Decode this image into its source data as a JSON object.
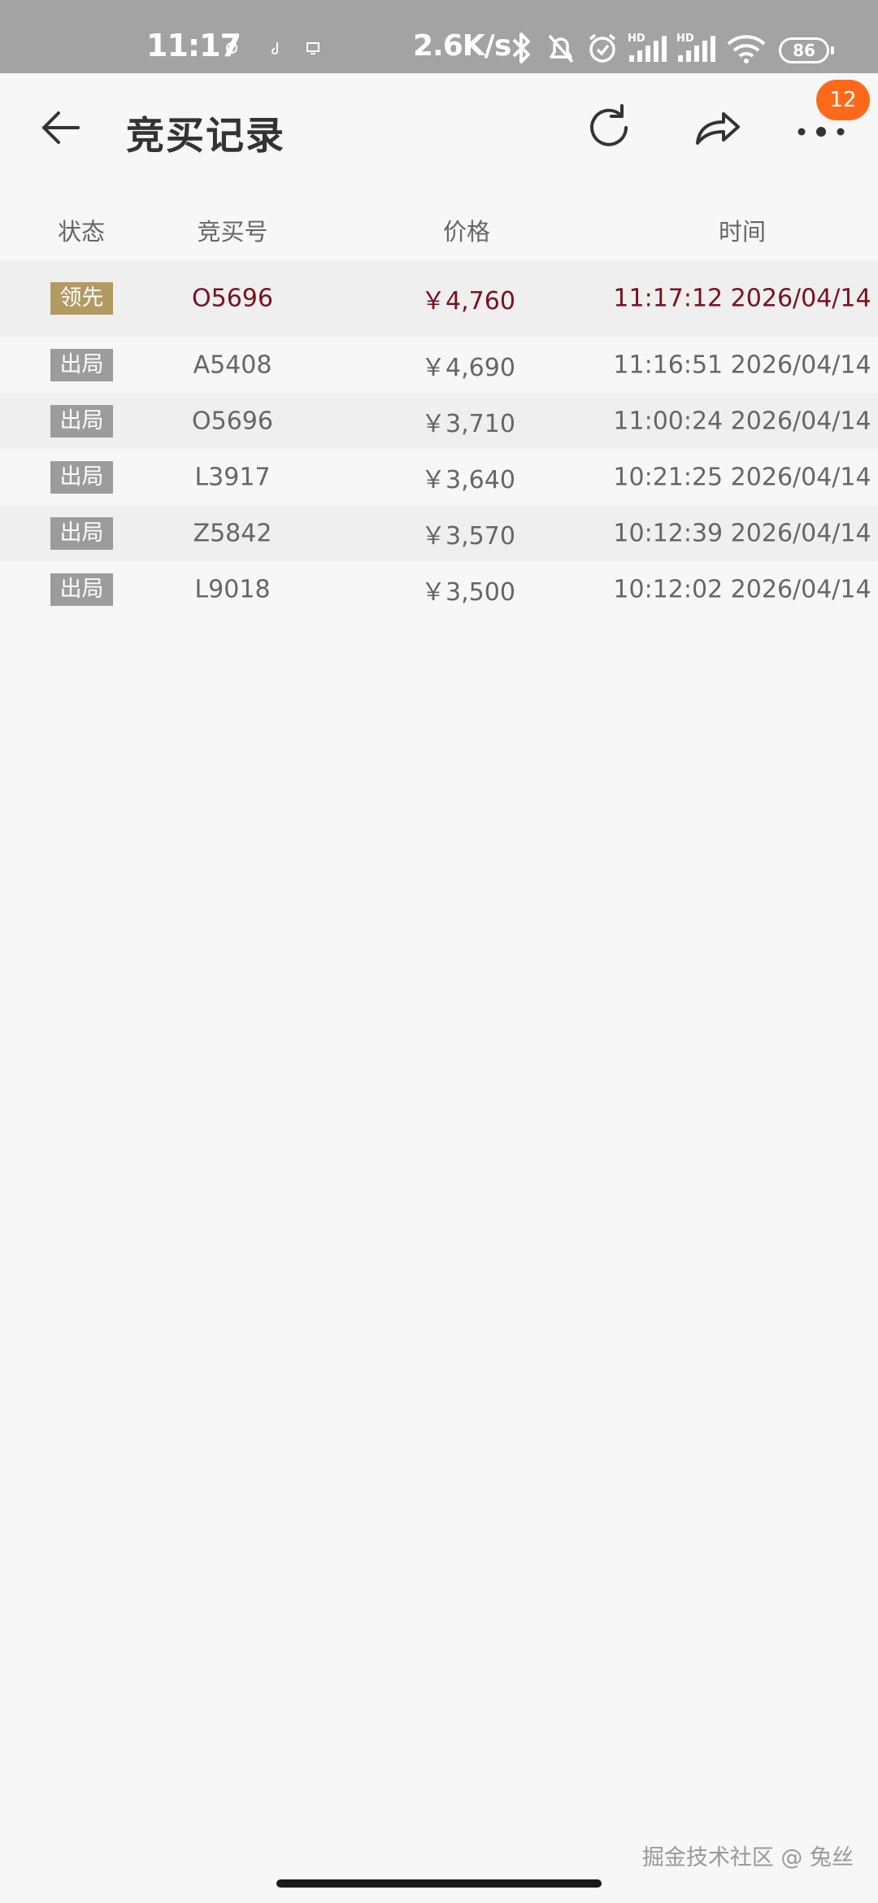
{
  "status_bar": {
    "time": "11:17",
    "speed": "2.6K/s",
    "hd_1": "HD",
    "hd_2": "HD",
    "battery": "86",
    "icons": [
      "gesture-icon",
      "music-note-icon",
      "screen-icon",
      "bluetooth-icon",
      "bell-off-icon",
      "alarm-icon",
      "signal-icon",
      "signal-icon",
      "wifi-icon",
      "battery-icon"
    ]
  },
  "header": {
    "title": "竞买记录",
    "badge_count": "12",
    "icons": [
      "back-arrow-icon",
      "refresh-icon",
      "share-icon",
      "more-dots-icon"
    ]
  },
  "table": {
    "columns": [
      "状态",
      "竞买号",
      "价格",
      "时间"
    ],
    "rows": [
      {
        "status": "领先",
        "bid_no": "O5696",
        "price": "￥4,760",
        "time": "11:17:12 2026/04/14"
      },
      {
        "status": "出局",
        "bid_no": "A5408",
        "price": "￥4,690",
        "time": "11:16:51 2026/04/14"
      },
      {
        "status": "出局",
        "bid_no": "O5696",
        "price": "￥3,710",
        "time": "11:00:24 2026/04/14"
      },
      {
        "status": "出局",
        "bid_no": "L3917",
        "price": "￥3,640",
        "time": "10:21:25 2026/04/14"
      },
      {
        "status": "出局",
        "bid_no": "Z5842",
        "price": "￥3,570",
        "time": "10:12:39 2026/04/14"
      },
      {
        "status": "出局",
        "bid_no": "L9018",
        "price": "￥3,500",
        "time": "10:12:02 2026/04/14"
      }
    ]
  },
  "watermark": "掘金技术社区 @ 兔丝",
  "colors": {
    "lead_tag": "#b39962",
    "out_tag": "#9c9c9c",
    "lead_text": "#7a1020",
    "badge": "#ff6a1a"
  }
}
